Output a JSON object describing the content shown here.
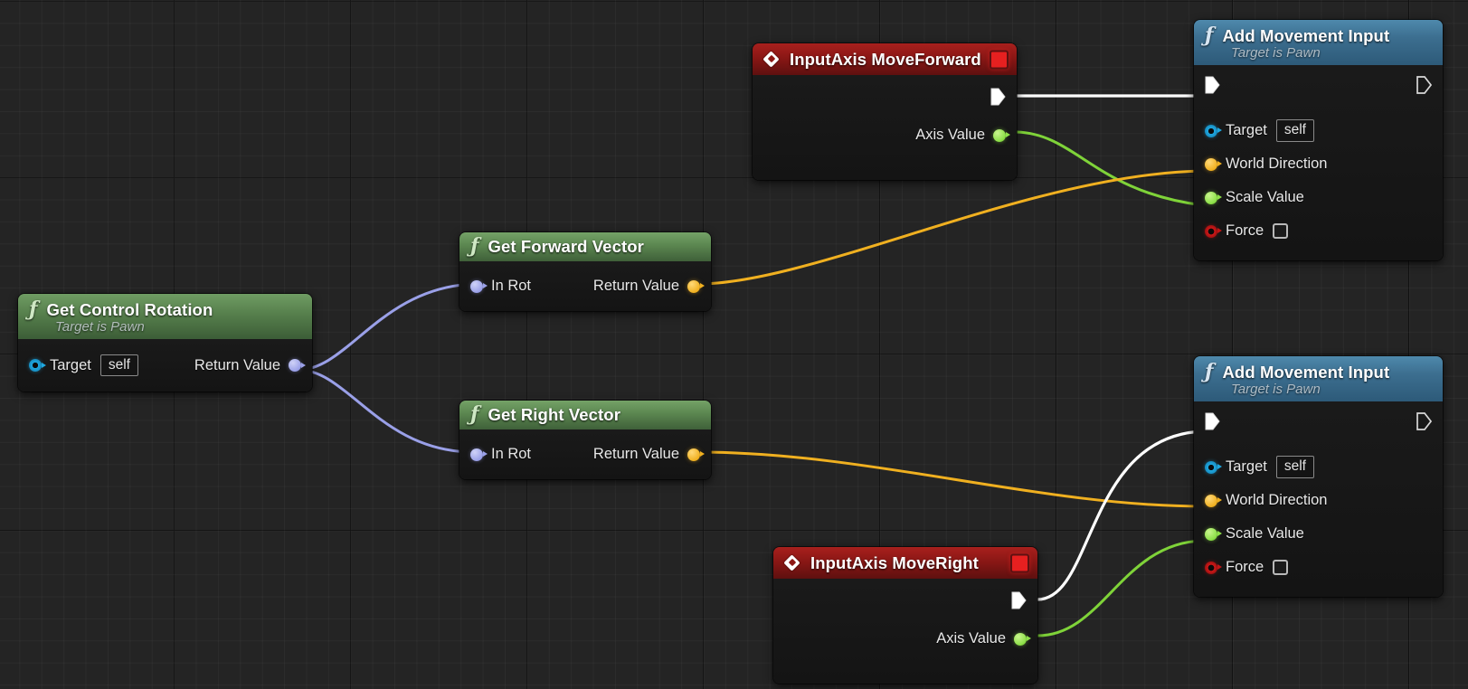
{
  "app": {
    "name": "Unreal Engine Blueprint Event Graph"
  },
  "colors": {
    "exec_white": "#ffffff",
    "vector_yellow": "#f0b020",
    "float_green": "#8ee04a",
    "struct_lavender": "#9aa0e8",
    "object_cyan": "#1fa8e0",
    "bool_red": "#c01616",
    "event_header_red": "#8a1715",
    "function_header_blue": "#3c6e8f",
    "pure_header_green": "#567f4c"
  },
  "nodes": {
    "input_axis_move_forward": {
      "title": "InputAxis MoveForward",
      "icon": "event-diamond-icon",
      "pins": {
        "exec_out": "",
        "axis_value": "Axis Value"
      }
    },
    "input_axis_move_right": {
      "title": "InputAxis MoveRight",
      "icon": "event-diamond-icon",
      "pins": {
        "exec_out": "",
        "axis_value": "Axis Value"
      }
    },
    "get_control_rotation": {
      "title": "Get Control Rotation",
      "subtitle": "Target is Pawn",
      "icon": "function-f-icon",
      "pins": {
        "target": "Target",
        "target_value": "self",
        "return_value": "Return Value"
      }
    },
    "get_forward_vector": {
      "title": "Get Forward Vector",
      "icon": "function-f-icon",
      "pins": {
        "in_rot": "In Rot",
        "return_value": "Return Value"
      }
    },
    "get_right_vector": {
      "title": "Get Right Vector",
      "icon": "function-f-icon",
      "pins": {
        "in_rot": "In Rot",
        "return_value": "Return Value"
      }
    },
    "add_movement_input_forward": {
      "title": "Add Movement Input",
      "subtitle": "Target is Pawn",
      "icon": "function-f-icon",
      "pins": {
        "target": "Target",
        "target_value": "self",
        "world_direction": "World Direction",
        "scale_value": "Scale Value",
        "force": "Force"
      }
    },
    "add_movement_input_right": {
      "title": "Add Movement Input",
      "subtitle": "Target is Pawn",
      "icon": "function-f-icon",
      "pins": {
        "target": "Target",
        "target_value": "self",
        "world_direction": "World Direction",
        "scale_value": "Scale Value",
        "force": "Force"
      }
    }
  }
}
